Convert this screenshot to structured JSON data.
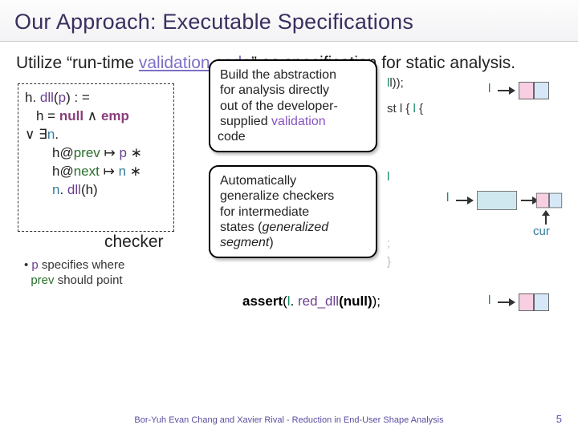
{
  "title": "Our Approach: Executable Specifications",
  "intro_pre": "Utilize “run-time ",
  "intro_valword": "validation code",
  "intro_post": "” as specification for static analysis.",
  "checker": {
    "l1_h": "h. ",
    "l1_dll": "dll",
    "l1_paren": "(",
    "l1_p": "p",
    "l1_close": ") : =",
    "l2_pre": "h = ",
    "l2_null": "null",
    "l2_and": " ∧ ",
    "l2_emp": "emp",
    "l3_or": "∨ ",
    "l3_exists": "∃",
    "l3_n": "n",
    "l3_dot": ".",
    "l4_h": "h@",
    "l4_prev": "prev",
    "l4_arrow": " ↦ ",
    "l4_p": "p",
    "l4_star": " ∗",
    "l5_h": "h@",
    "l5_next": "next",
    "l5_arrow": " ↦ ",
    "l5_n": "n",
    "l5_star": " ∗",
    "l6_n": "n",
    "l6_dot": ". ",
    "l6_dll": "dll",
    "l6_hparen": "(h)"
  },
  "checker_label": "checker",
  "checker_note_bullet": "• ",
  "checker_note_p": "p",
  "checker_note_text1": " specifies where",
  "checker_note_prev": "prev",
  "checker_note_text2": " should point",
  "callout1_a": "Build the abstraction",
  "callout1_b": "for analysis directly",
  "callout1_c": "out of the developer-",
  "callout1_d_pre": "supplied ",
  "callout1_d_val": "validation",
  "callout1_d_code": " code",
  "callout2_a": "Automatically",
  "callout2_b": "generalize checkers",
  "callout2_c": "for intermediate",
  "callout2_d_pre": "states (",
  "callout2_d_gs": "generalized segment",
  "callout2_d_post": ")",
  "code_right": {
    "r1_tail": "l));",
    "r2_tail": "st l {",
    "r3_l": "l",
    "r4_close": "}",
    "mid1": ";",
    "assert_kw": "assert",
    "assert_paren": "(",
    "assert_l": "l",
    "assert_dot": ". ",
    "assert_dll": "red_dll",
    "assert_null": "(null)",
    "assert_end": ");"
  },
  "labels": {
    "l": "l",
    "cur": "cur"
  },
  "footer": "Bor-Yuh Evan Chang and Xavier Rival - Reduction in End-User Shape Analysis",
  "page": "5"
}
